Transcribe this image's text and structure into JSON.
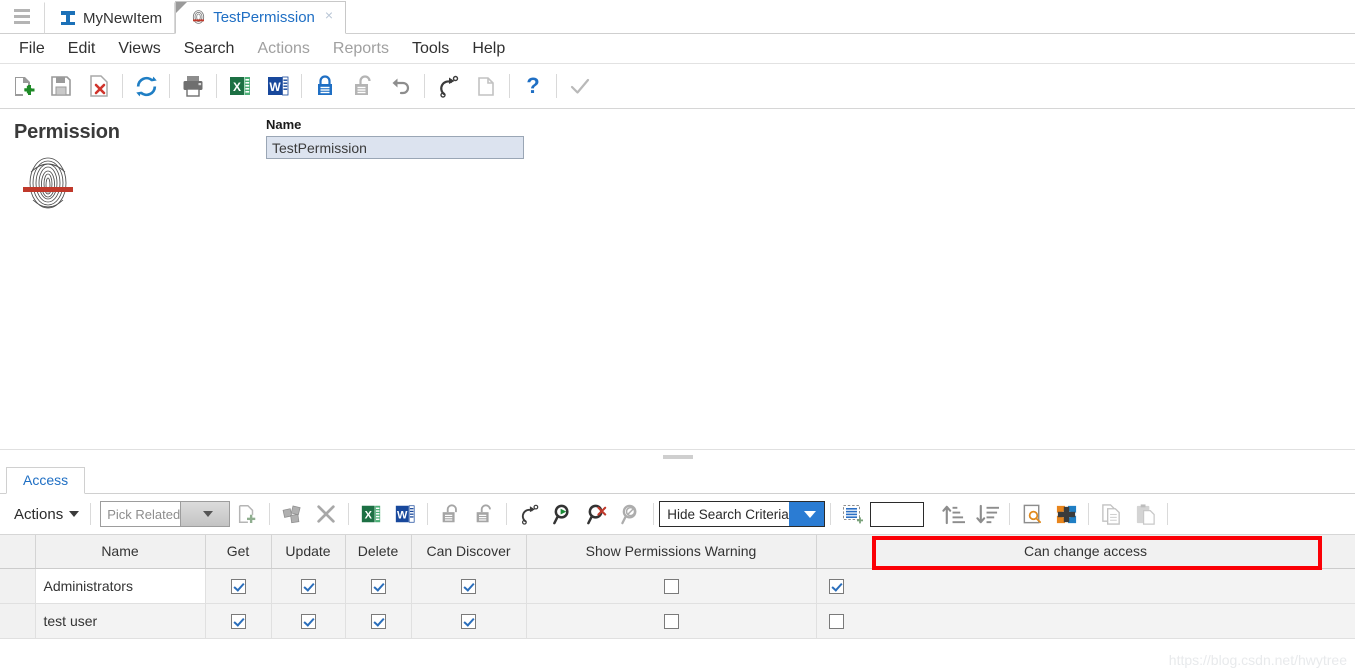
{
  "window": {
    "hamburger_icon": "hamburger-menu-icon",
    "tabs": [
      {
        "label": "MyNewItem",
        "icon": "ibeam-logo-icon",
        "active": false,
        "closable": false
      },
      {
        "label": "TestPermission",
        "icon": "fingerprint-icon",
        "active": true,
        "closable": true,
        "close_label": "×"
      }
    ]
  },
  "menubar": {
    "items": [
      {
        "label": "File",
        "disabled": false
      },
      {
        "label": "Edit",
        "disabled": false
      },
      {
        "label": "Views",
        "disabled": false
      },
      {
        "label": "Search",
        "disabled": false
      },
      {
        "label": "Actions",
        "disabled": true
      },
      {
        "label": "Reports",
        "disabled": true
      },
      {
        "label": "Tools",
        "disabled": false
      },
      {
        "label": "Help",
        "disabled": false
      }
    ]
  },
  "toolbar": {
    "buttons": [
      {
        "name": "new-item-icon",
        "title": "New"
      },
      {
        "name": "save-icon",
        "title": "Save"
      },
      {
        "name": "delete-icon",
        "title": "Delete"
      },
      {
        "name": "refresh-icon",
        "title": "Refresh"
      },
      {
        "name": "print-icon",
        "title": "Print"
      },
      {
        "name": "export-excel-icon",
        "title": "Export to Excel"
      },
      {
        "name": "export-word-icon",
        "title": "Export to Word"
      },
      {
        "name": "lock-icon",
        "title": "Lock"
      },
      {
        "name": "unlock-icon",
        "title": "Unlock"
      },
      {
        "name": "undo-icon",
        "title": "Undo"
      },
      {
        "name": "redo-icon",
        "title": "Redo"
      },
      {
        "name": "copy-page-icon",
        "title": "Copy"
      },
      {
        "name": "help-question-icon",
        "title": "Help"
      },
      {
        "name": "checkmark-icon",
        "title": "Apply"
      }
    ]
  },
  "form": {
    "entity_title": "Permission",
    "entity_icon": "fingerprint-icon",
    "name_label": "Name",
    "name_value": "TestPermission"
  },
  "panel": {
    "tabs": [
      {
        "label": "Access",
        "active": true
      }
    ],
    "actions_label": "Actions",
    "pick_related_placeholder": "Pick Related",
    "hide_search_criteria_label": "Hide Search Criteria",
    "filter_value": "",
    "buttons": [
      {
        "name": "add-row-icon",
        "title": "Add"
      },
      {
        "name": "relate-icon",
        "title": "Relate"
      },
      {
        "name": "remove-x-icon",
        "title": "Remove"
      },
      {
        "name": "export-excel-icon",
        "title": "Excel"
      },
      {
        "name": "export-word-icon",
        "title": "Word"
      },
      {
        "name": "lock-icon",
        "title": "Lock"
      },
      {
        "name": "unlock-icon",
        "title": "Unlock"
      },
      {
        "name": "redo-icon",
        "title": "Redo"
      },
      {
        "name": "search-run-icon",
        "title": "Run Search"
      },
      {
        "name": "search-clear-icon",
        "title": "Clear Search"
      },
      {
        "name": "search-disabled-icon",
        "title": "Search Off"
      },
      {
        "name": "insert-rows-icon",
        "title": "Insert Rows"
      },
      {
        "name": "sort-ascending-icon",
        "title": "Sort Ascending"
      },
      {
        "name": "sort-descending-icon",
        "title": "Sort Descending"
      },
      {
        "name": "find-in-page-icon",
        "title": "Find"
      },
      {
        "name": "pivot-grid-icon",
        "title": "Pivot"
      },
      {
        "name": "copy-icon",
        "title": "Copy"
      },
      {
        "name": "paste-icon",
        "title": "Paste"
      }
    ]
  },
  "grid": {
    "columns": [
      "Name",
      "Get",
      "Update",
      "Delete",
      "Can Discover",
      "Show Permissions Warning",
      "Can change access"
    ],
    "highlighted_column": "Can change access",
    "highlight_color": "#fb0006",
    "rows": [
      {
        "name": "Administrators",
        "get": true,
        "update": true,
        "delete": true,
        "can_discover": true,
        "show_permissions_warning": false,
        "can_change_access": true
      },
      {
        "name": "test user",
        "get": true,
        "update": true,
        "delete": true,
        "can_discover": true,
        "show_permissions_warning": false,
        "can_change_access": false
      }
    ]
  },
  "watermark": "https://blog.csdn.net/hwytree"
}
